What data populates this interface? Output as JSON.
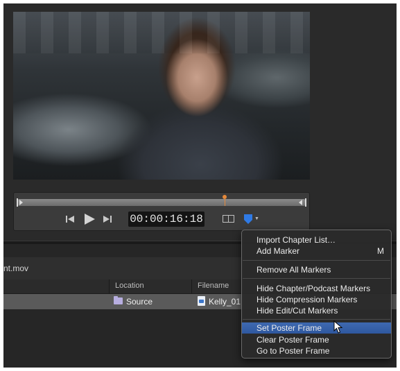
{
  "player": {
    "timecode": "00:00:16:18",
    "progress": 0.72,
    "icons": [
      "go-to-start-icon",
      "play-icon",
      "go-to-end-icon",
      "split-view-icon",
      "chapter-marker-icon"
    ]
  },
  "file": {
    "name": "nt.mov"
  },
  "table": {
    "headers": {
      "location": "Location",
      "filename": "Filename"
    },
    "row": {
      "location": "Source",
      "filename": "Kelly_01"
    }
  },
  "menu": {
    "items": [
      {
        "label": "Import Chapter List…",
        "shortcut": ""
      },
      {
        "label": "Add Marker",
        "shortcut": "M"
      },
      {
        "label": "Remove All Markers",
        "shortcut": ""
      },
      {
        "label": "Hide Chapter/Podcast Markers",
        "shortcut": ""
      },
      {
        "label": "Hide Compression Markers",
        "shortcut": ""
      },
      {
        "label": "Hide Edit/Cut Markers",
        "shortcut": ""
      },
      {
        "label": "Set Poster Frame",
        "shortcut": "",
        "selected": true
      },
      {
        "label": "Clear Poster Frame",
        "shortcut": ""
      },
      {
        "label": "Go to Poster Frame",
        "shortcut": ""
      }
    ]
  },
  "colors": {
    "accent": "#2f58a0",
    "playhead": "#e5893a",
    "marker": "#2f7ae5"
  }
}
